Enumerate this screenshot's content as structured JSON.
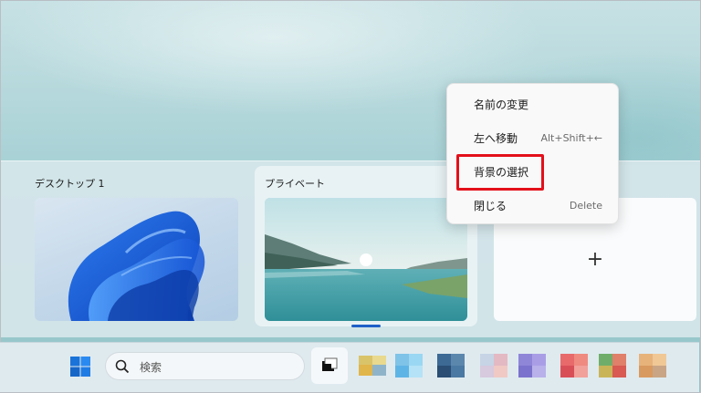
{
  "desktops": [
    {
      "title": "デスクトップ 1",
      "active": false
    },
    {
      "title": "プライベート",
      "active": true
    }
  ],
  "new_desktop": {
    "symbol": "+"
  },
  "context_menu": {
    "items": [
      {
        "label": "名前の変更",
        "shortcut": ""
      },
      {
        "label": "左へ移動",
        "shortcut": "Alt+Shift+←"
      },
      {
        "label": "背景の選択",
        "shortcut": ""
      },
      {
        "label": "閉じる",
        "shortcut": "Delete"
      }
    ]
  },
  "taskbar": {
    "search_placeholder": "検索",
    "start_icon": "windows-logo-icon",
    "search_icon": "search-icon",
    "taskview_icon": "task-view-icon",
    "pinned_apps": [
      "file-explorer-icon",
      "app-icon",
      "app-icon",
      "app-icon",
      "app-icon",
      "app-icon",
      "app-icon",
      "app-icon",
      "app-icon"
    ]
  },
  "colors": {
    "highlight": "#e3101a",
    "accent": "#1f5fc8",
    "taskbar": "#dfeaef"
  }
}
